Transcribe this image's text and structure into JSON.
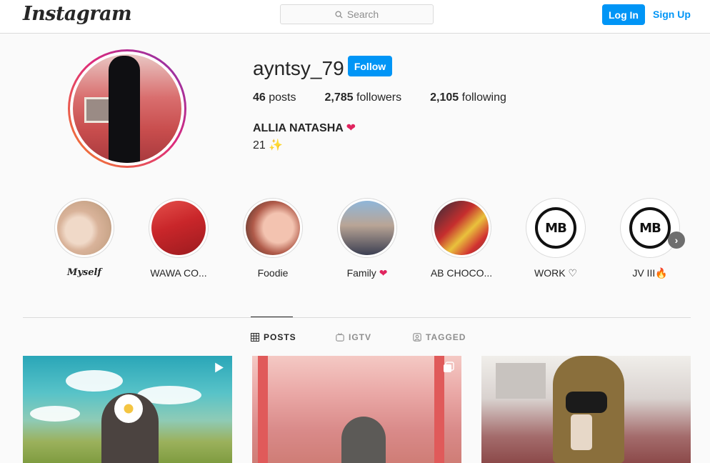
{
  "header": {
    "logo": "Instagram",
    "search_placeholder": "Search",
    "login_label": "Log In",
    "signup_label": "Sign Up"
  },
  "profile": {
    "username": "ayntsy_79",
    "follow_label": "Follow",
    "stats": {
      "posts_count": "46",
      "posts_label": "posts",
      "followers_count": "2,785",
      "followers_label": "followers",
      "following_count": "2,105",
      "following_label": "following"
    },
    "full_name": "ALLIA NATASHA",
    "full_name_emoji": "❤",
    "bio": "21",
    "bio_emoji": "✨"
  },
  "highlights": [
    {
      "label": "Myself",
      "icon": "photo"
    },
    {
      "label": "WAWA CO...",
      "icon": "photo"
    },
    {
      "label": "Foodie",
      "icon": "photo"
    },
    {
      "label": "Family",
      "suffix": "❤",
      "icon": "photo"
    },
    {
      "label": "AB CHOCO...",
      "icon": "photo"
    },
    {
      "label": "WORK",
      "suffix": "♡",
      "icon": "mb-logo",
      "logo_text": "MB"
    },
    {
      "label": "JV III",
      "suffix": "🔥",
      "icon": "mb-logo",
      "logo_text": "MB"
    }
  ],
  "tabs": [
    {
      "label": "POSTS",
      "icon": "grid-icon",
      "active": true
    },
    {
      "label": "IGTV",
      "icon": "igtv-icon",
      "active": false
    },
    {
      "label": "TAGGED",
      "icon": "tagged-icon",
      "active": false
    }
  ],
  "posts": [
    {
      "type": "video",
      "badge_icon": "play-icon"
    },
    {
      "type": "carousel",
      "badge_icon": "carousel-icon"
    },
    {
      "type": "photo"
    }
  ],
  "colors": {
    "accent": "#0095f6",
    "text": "#262626",
    "muted": "#8e8e8e",
    "border": "#dbdbdb",
    "background": "#fafafa"
  }
}
